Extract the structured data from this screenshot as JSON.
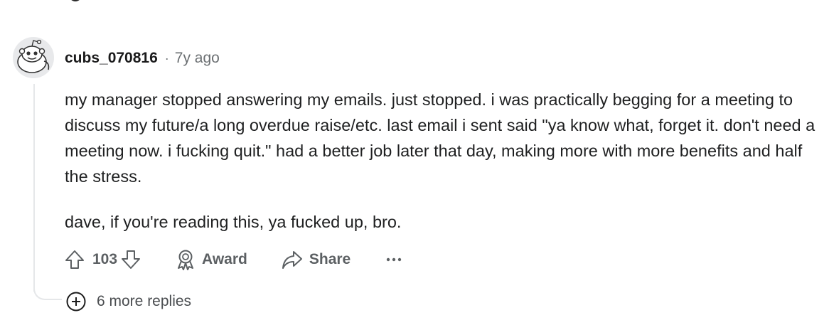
{
  "comment": {
    "avatar_icon": "snoo-avatar-icon",
    "username": "cubs_070816",
    "separator": "·",
    "age": "7y ago",
    "paragraphs": [
      "my manager stopped answering my emails. just stopped. i was practically begging for a meeting to discuss my future/a long overdue raise/etc. last email i sent said \"ya know what, forget it. don't need a meeting now. i fucking quit.\" had a better job later that day, making more with more benefits and half the stress.",
      "dave, if you're reading this, ya fucked up, bro."
    ]
  },
  "actions": {
    "upvote_icon": "upvote-arrow-icon",
    "vote_count": "103",
    "downvote_icon": "downvote-arrow-icon",
    "award_icon": "award-ribbon-icon",
    "award_label": "Award",
    "share_icon": "share-arrow-icon",
    "share_label": "Share",
    "more_icon": "ellipsis-icon"
  },
  "replies": {
    "expand_icon": "plus-circle-icon",
    "label": "6 more replies"
  },
  "colors": {
    "text": "#1f2021",
    "muted": "#6b6f72",
    "thread_line": "#e5e7e9",
    "avatar_bg": "#e8e9eb"
  }
}
